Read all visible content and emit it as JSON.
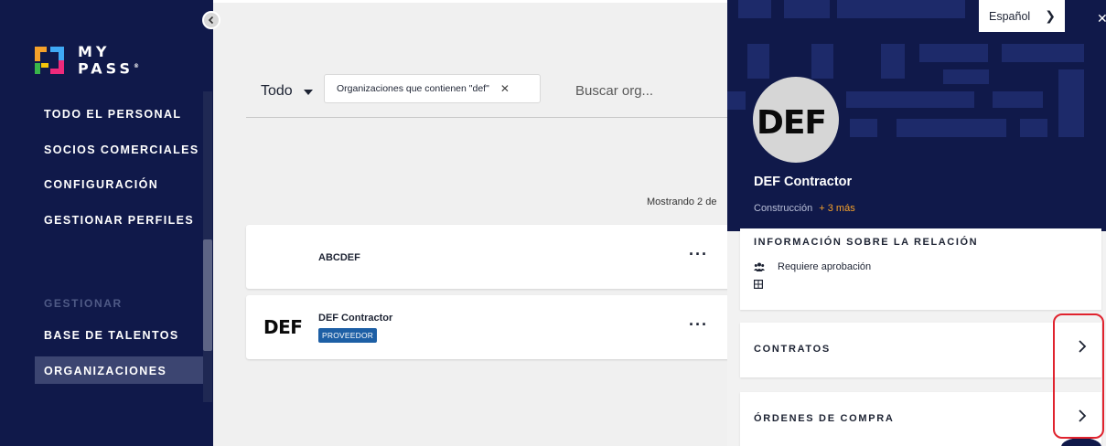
{
  "sidebar": {
    "logo_text": "MY PASS",
    "nav": [
      {
        "label": "TODO EL PERSONAL"
      },
      {
        "label": "SOCIOS COMERCIALES"
      },
      {
        "label": "CONFIGURACIÓN"
      },
      {
        "label": "GESTIONAR PERFILES"
      }
    ],
    "section_label": "GESTIONAR",
    "manage_items": [
      {
        "label": "BASE DE TALENTOS"
      },
      {
        "label": "ORGANIZACIONES",
        "active": true
      }
    ]
  },
  "main": {
    "filter_select": "Todo",
    "filter_chip": "Organizaciones que contienen \"def\"",
    "search_placeholder": "Buscar org...",
    "showing_text": "Mostrando 2 de",
    "organizations": [
      {
        "name": "ABCDEF",
        "logo": "",
        "badge": ""
      },
      {
        "name": "DEF Contractor",
        "logo": "DEF",
        "badge": "PROVEEDOR"
      }
    ]
  },
  "panel": {
    "language": "Español",
    "avatar_text": "DEF",
    "title": "DEF Contractor",
    "subtitle": "Construcción",
    "subtitle_more": "+ 3 más",
    "relation_title": "INFORMACIÓN SOBRE LA RELACIÓN",
    "relation_status": "Requiere aprobación",
    "links": [
      {
        "label": "CONTRATOS"
      },
      {
        "label": "ÓRDENES DE COMPRA"
      }
    ]
  },
  "colors": {
    "navy": "#10194a",
    "accent_orange": "#f5a12a",
    "badge_blue": "#1d5fa5",
    "highlight_red": "#e0232e"
  }
}
